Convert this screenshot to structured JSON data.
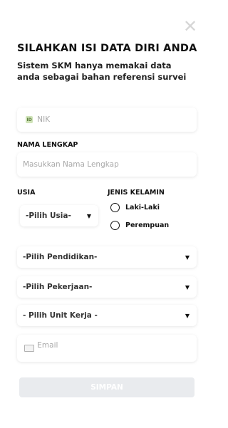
{
  "header": {
    "close_glyph": "✕",
    "title": "SILAHKAN ISI DATA DIRI ANDA",
    "subtitle": "Sistem SKM hanya memakai data anda sebagai bahan referensi survei"
  },
  "form": {
    "nik": {
      "icon_text": "ID",
      "placeholder": "NIK"
    },
    "nama": {
      "label": "NAMA LENGKAP",
      "placeholder": "Masukkan Nama Lengkap"
    },
    "usia": {
      "label": "USIA",
      "selected": "-Pilih Usia-"
    },
    "gender": {
      "label": "JENIS KELAMIN",
      "options": [
        "Laki-Laki",
        "Perempuan"
      ]
    },
    "pendidikan": {
      "selected": "-Pilih Pendidikan-"
    },
    "pekerjaan": {
      "selected": "-Pilih Pekerjaan-"
    },
    "unit_kerja": {
      "selected": "- Pilih Unit Kerja -"
    },
    "email": {
      "placeholder": "Email"
    },
    "submit_label": "SIMPAN"
  },
  "icons": {
    "close": "close-icon",
    "nik": "id-card-icon",
    "email": "email-icon",
    "dropdown": "chevron-down-icon"
  },
  "colors": {
    "submit_disabled_bg": "#e9ebee",
    "close_icon": "#d6d6d6",
    "id_icon_bg": "#cfe3b8"
  }
}
